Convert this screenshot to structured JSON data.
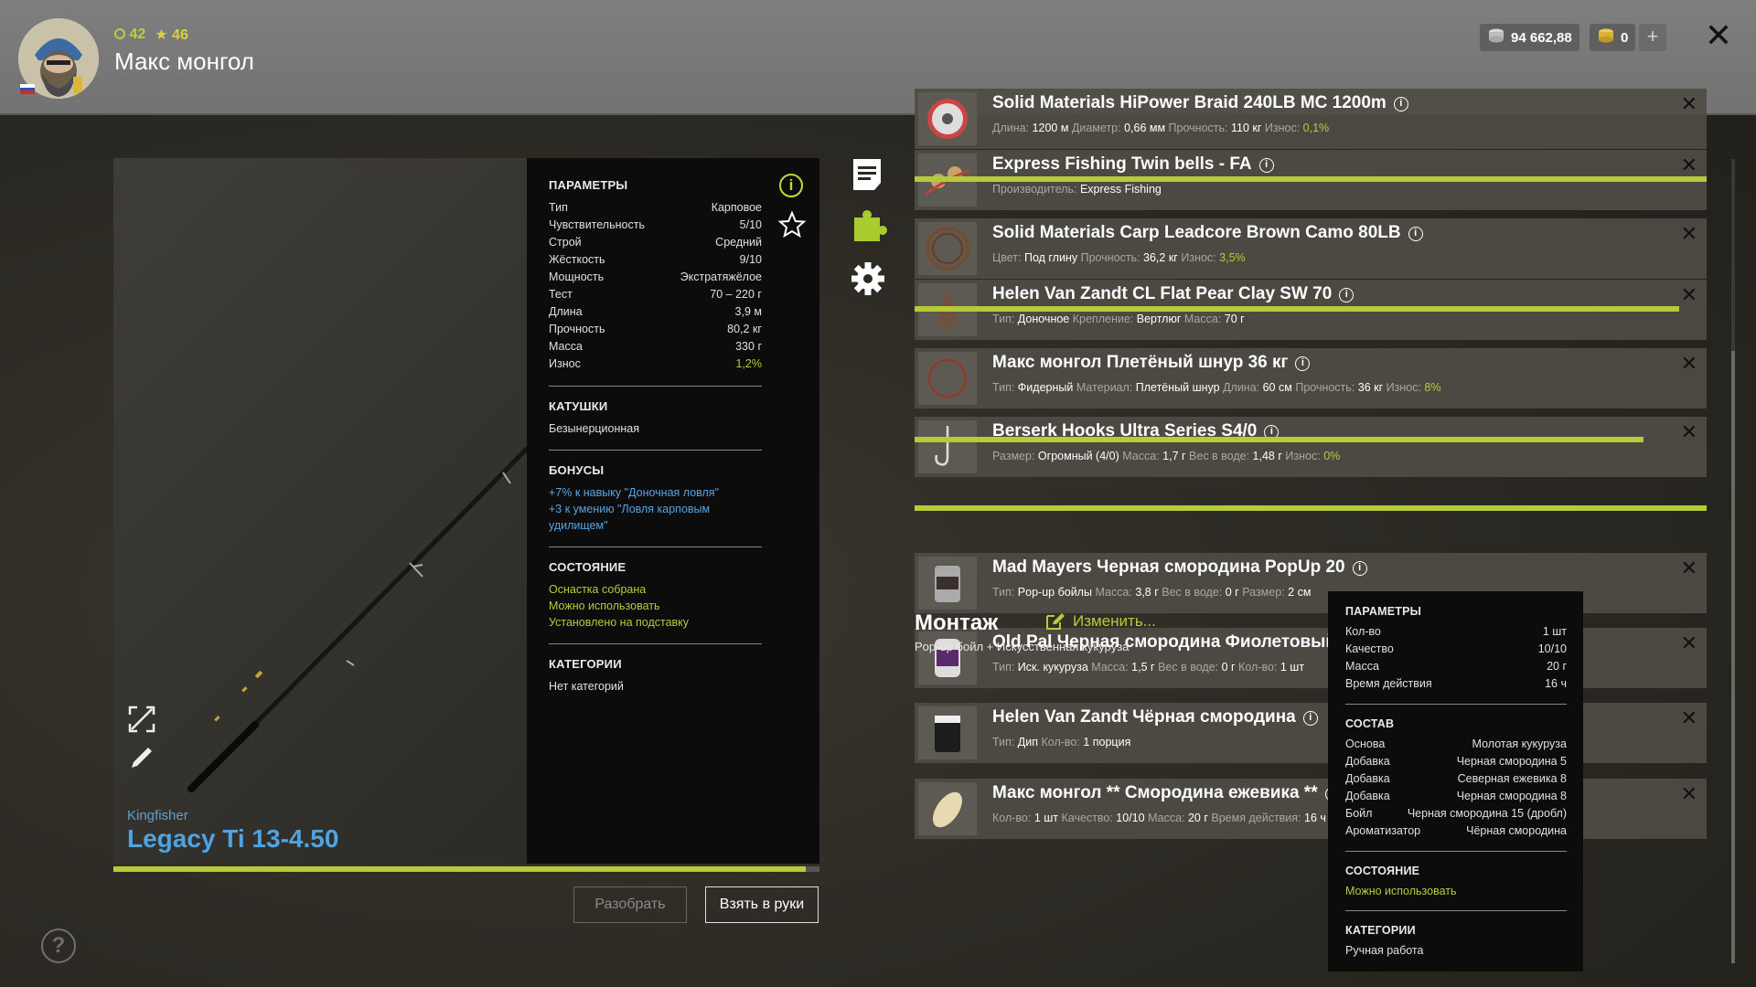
{
  "header": {
    "level": "42",
    "rating": "46",
    "player_name": "Макс монгол",
    "silver": "94 662,88",
    "gold": "0",
    "plus": "+",
    "close": "✕"
  },
  "rod": {
    "brand": "Kingfisher",
    "name": "Legacy Ti 13-4.50",
    "wear_fraction": 0.98
  },
  "params": {
    "title": "ПАРАМЕТРЫ",
    "rows": [
      {
        "k": "Тип",
        "v": "Карповое"
      },
      {
        "k": "Чувствительность",
        "v": "5/10"
      },
      {
        "k": "Строй",
        "v": "Средний"
      },
      {
        "k": "Жёсткость",
        "v": "9/10"
      },
      {
        "k": "Мощность",
        "v": "Экстратяжёлое"
      },
      {
        "k": "Тест",
        "v": "70 – 220 г"
      },
      {
        "k": "Длина",
        "v": "3,9 м"
      },
      {
        "k": "Прочность",
        "v": "80,2 кг"
      },
      {
        "k": "Масса",
        "v": "330 г"
      },
      {
        "k": "Износ",
        "v": "1,2%"
      }
    ],
    "reels_title": "КАТУШКИ",
    "reels_value": "Безынерционная",
    "bonuses_title": "БОНУСЫ",
    "bonus_1": "+7% к навыку \"Доночная ловля\"",
    "bonus_2": "+3 к умению \"Ловля карповым удилищем\"",
    "state_title": "СОСТОЯНИЕ",
    "state_1": "Оснастка собрана",
    "state_2": "Можно использовать",
    "state_3": "Установлено на подставку",
    "cat_title": "КАТЕГОРИИ",
    "cat_value": "Нет категорий"
  },
  "buttons": {
    "disassemble": "Разобрать",
    "take": "Взять в руки"
  },
  "items": [
    {
      "title": "Solid Materials HiPower Braid 240LB MC 1200m",
      "sub": [
        [
          "Длина:",
          "1200 м"
        ],
        [
          "Диаметр:",
          "0,66 мм"
        ],
        [
          "Прочность:",
          "110 кг"
        ],
        [
          "Износ:",
          "0,1%"
        ]
      ],
      "wear": 1.0
    },
    {
      "title": "Express Fishing Twin bells - FA",
      "sub": [
        [
          "Производитель:",
          "Express Fishing"
        ]
      ]
    },
    {
      "title": "Solid Materials Carp Leadcore Brown Camo 80LB",
      "sub": [
        [
          "Цвет:",
          "Под глину"
        ],
        [
          "Прочность:",
          "36,2 кг"
        ],
        [
          "Износ:",
          "3,5%"
        ]
      ],
      "wear": 0.965
    },
    {
      "title": "Helen Van Zandt CL Flat Pear Clay SW 70",
      "sub": [
        [
          "Тип:",
          "Доночное"
        ],
        [
          "Крепление:",
          "Вертлюг"
        ],
        [
          "Масса:",
          "70 г"
        ]
      ]
    },
    {
      "title": "Макс монгол Плетёный шнур 36 кг",
      "sub": [
        [
          "Тип:",
          "Фидерный"
        ],
        [
          "Материал:",
          "Плетёный шнур"
        ],
        [
          "Длина:",
          "60 см"
        ],
        [
          "Прочность:",
          "36 кг"
        ],
        [
          "Износ:",
          "8%"
        ]
      ],
      "wear": 0.92
    },
    {
      "title": "Berserk Hooks Ultra Series S4/0",
      "sub": [
        [
          "Размер:",
          "Огромный (4/0)"
        ],
        [
          "Масса:",
          "1,7 г"
        ],
        [
          "Вес в воде:",
          "1,48 г"
        ],
        [
          "Износ:",
          "0%"
        ]
      ],
      "wear": 1.0
    }
  ],
  "montage": {
    "title": "Монтаж",
    "edit": "Изменить...",
    "subtitle": "Pop-up бойл  +  Искусственная кукуруза"
  },
  "baits": [
    {
      "title": "Mad Mayers Черная смородина PopUp 20",
      "sub": [
        [
          "Тип:",
          "Pop-up бойлы"
        ],
        [
          "Масса:",
          "3,8 г"
        ],
        [
          "Вес в воде:",
          "0 г"
        ],
        [
          "Размер:",
          "2 см"
        ]
      ]
    },
    {
      "title": "Old Pal Черная смородина Фиолетовый",
      "sub": [
        [
          "Тип:",
          "Иск. кукуруза"
        ],
        [
          "Масса:",
          "1,5 г"
        ],
        [
          "Вес в воде:",
          "0 г"
        ],
        [
          "Кол-во:",
          "1 шт"
        ]
      ]
    },
    {
      "title": "Helen Van Zandt Чёрная смородина",
      "sub": [
        [
          "Тип:",
          "Дип"
        ],
        [
          "Кол-во:",
          "1 порция"
        ]
      ]
    },
    {
      "title": "Макс монгол ** Смородина ежевика **",
      "sub": [
        [
          "Кол-во:",
          "1 шт"
        ],
        [
          "Качество:",
          "10/10"
        ],
        [
          "Масса:",
          "20 г"
        ],
        [
          "Время действия:",
          "16 ч"
        ]
      ]
    }
  ],
  "tooltip": {
    "params_title": "ПАРАМЕТРЫ",
    "params": [
      {
        "k": "Кол-во",
        "v": "1 шт"
      },
      {
        "k": "Качество",
        "v": "10/10"
      },
      {
        "k": "Масса",
        "v": "20 г"
      },
      {
        "k": "Время действия",
        "v": "16 ч"
      }
    ],
    "comp_title": "СОСТАВ",
    "comp": [
      {
        "k": "Основа",
        "v": "Молотая кукуруза"
      },
      {
        "k": "Добавка",
        "v": "Черная смородина 5"
      },
      {
        "k": "Добавка",
        "v": "Северная ежевика 8"
      },
      {
        "k": "Добавка",
        "v": "Черная смородина 8"
      },
      {
        "k": "Бойл",
        "v": "Черная смородина 15 (дробл)"
      },
      {
        "k": "Ароматизатор",
        "v": "Чёрная смородина"
      }
    ],
    "state_title": "СОСТОЯНИЕ",
    "state_value": "Можно использовать",
    "cat_title": "КАТЕГОРИИ",
    "cat_value": "Ручная работа"
  },
  "icons": {
    "info": "info-icon",
    "favorite": "star-icon",
    "notes": "notes-icon",
    "puzzle": "puzzle-icon",
    "settings": "gear-icon",
    "expand": "expand-icon",
    "edit": "pencil-icon",
    "help": "help-icon"
  },
  "colors": {
    "accent": "#b6cb3a",
    "link": "#4fa3e0"
  }
}
